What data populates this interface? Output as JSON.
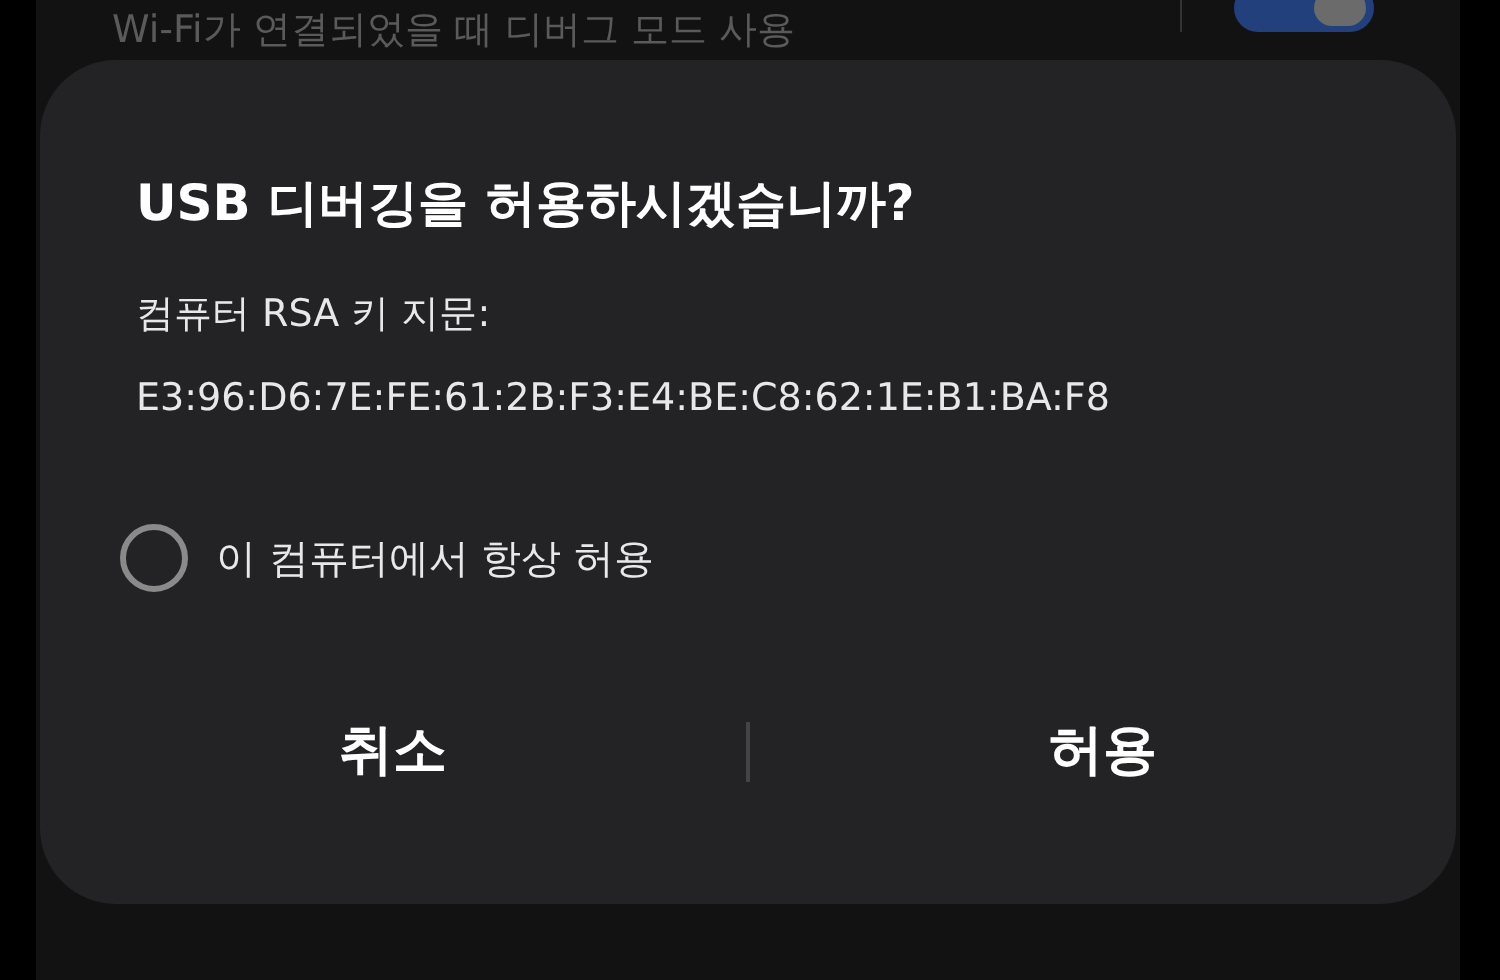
{
  "background": {
    "setting_label": "Wi-Fi가 연결되었을 때 디버그 모드 사용",
    "toggle_on": true
  },
  "dialog": {
    "title": "USB 디버깅을 허용하시겠습니까?",
    "fingerprint_label": "컴퓨터 RSA 키 지문:",
    "fingerprint": "E3:96:D6:7E:FE:61:2B:F3:E4:BE:C8:62:1E:B1:BA:F8",
    "always_allow": {
      "label": "이 컴퓨터에서 항상 허용",
      "checked": false
    },
    "buttons": [
      "취소",
      "허용"
    ]
  }
}
